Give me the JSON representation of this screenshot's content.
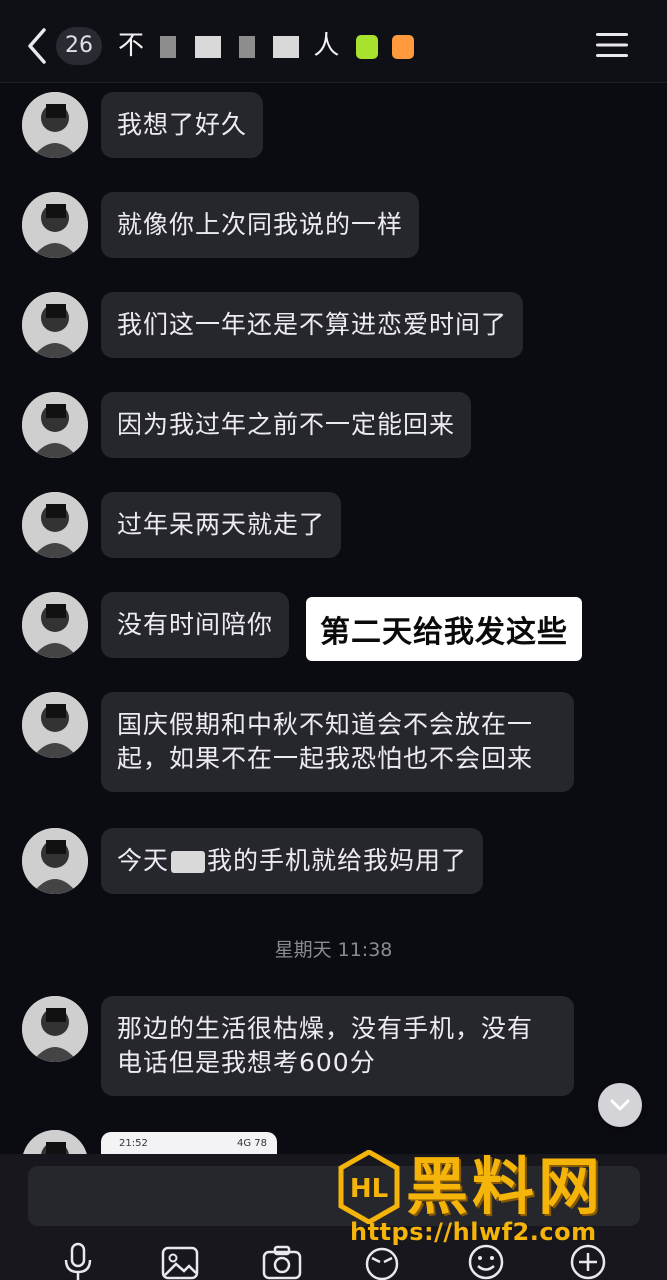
{
  "header": {
    "unread_count": "26",
    "title_prefix": "不",
    "title_suffix": "人"
  },
  "messages": [
    {
      "text": "我想了好久"
    },
    {
      "text": "就像你上次同我说的一样"
    },
    {
      "text": "我们这一年还是不算进恋爱时间了"
    },
    {
      "text": "因为我过年之前不一定能回来"
    },
    {
      "text": "过年呆两天就走了"
    },
    {
      "text": "没有时间陪你"
    },
    {
      "text": "国庆假期和中秋不知道会不会放在一起，如果不在一起我恐怕也不会回来"
    },
    {
      "text_before": "今天",
      "text_after": "我的手机就给我妈用了"
    },
    {
      "text": "那边的生活很枯燥，没有手机，没有电话但是我想考600分"
    }
  ],
  "overlay_caption": "第二天给我发这些",
  "time_divider": "星期天 11:38",
  "image_preview": {
    "time": "21:52",
    "status": "4G 78"
  },
  "watermark": {
    "brand": "黑料网",
    "logo": "HL",
    "url": "https://hlwf2.com"
  },
  "colors": {
    "background": "#0b0b12",
    "bubble": "#26262d",
    "watermark": "#f5b40a"
  },
  "toolbar_icons": [
    "microphone-icon",
    "image-icon",
    "camera-icon",
    "sticker-icon",
    "emoji-icon",
    "plus-icon"
  ]
}
